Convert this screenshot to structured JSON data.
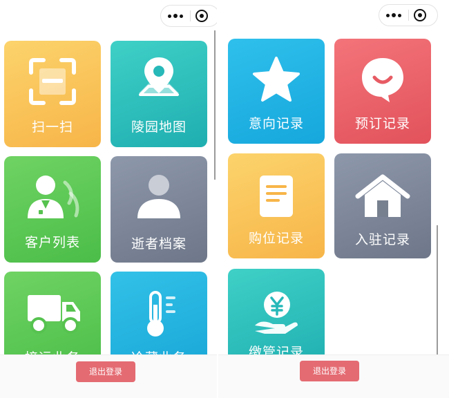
{
  "capsule": {
    "more_icon": "more-dots-icon",
    "close_icon": "target-circle-icon"
  },
  "left_panel": {
    "tiles": [
      {
        "label": "扫一扫",
        "icon": "scan-icon",
        "colors": [
          "#fcd36c",
          "#f7b548"
        ]
      },
      {
        "label": "陵园地图",
        "icon": "map-pin-icon",
        "colors": [
          "#3fd0c7",
          "#1faeb0"
        ]
      },
      {
        "label": "客户列表",
        "icon": "customers-icon",
        "colors": [
          "#6fd363",
          "#4bbd48"
        ]
      },
      {
        "label": "逝者档案",
        "icon": "person-icon",
        "colors": [
          "#8e98ab",
          "#6e7789"
        ]
      },
      {
        "label": "接运业务",
        "icon": "truck-icon",
        "colors": [
          "#6fd363",
          "#4bbd48"
        ]
      },
      {
        "label": "冷藏业务",
        "icon": "thermometer-icon",
        "colors": [
          "#32c1e7",
          "#18a6d7"
        ]
      }
    ],
    "logout_label": "退出登录"
  },
  "right_panel": {
    "tiles": [
      {
        "label": "意向记录",
        "icon": "star-icon",
        "colors": [
          "#2fc0ec",
          "#16a7dc"
        ]
      },
      {
        "label": "预订记录",
        "icon": "smile-bubble-icon",
        "colors": [
          "#f3747a",
          "#e2525b"
        ]
      },
      {
        "label": "购位记录",
        "icon": "document-icon",
        "colors": [
          "#fcd36c",
          "#f7b548"
        ]
      },
      {
        "label": "入驻记录",
        "icon": "house-icon",
        "colors": [
          "#8e98ab",
          "#6e7789"
        ]
      },
      {
        "label": "缴管记录",
        "icon": "yuan-hand-icon",
        "colors": [
          "#3fd0c7",
          "#1faeb0"
        ]
      }
    ],
    "logout_label": "退出登录"
  }
}
